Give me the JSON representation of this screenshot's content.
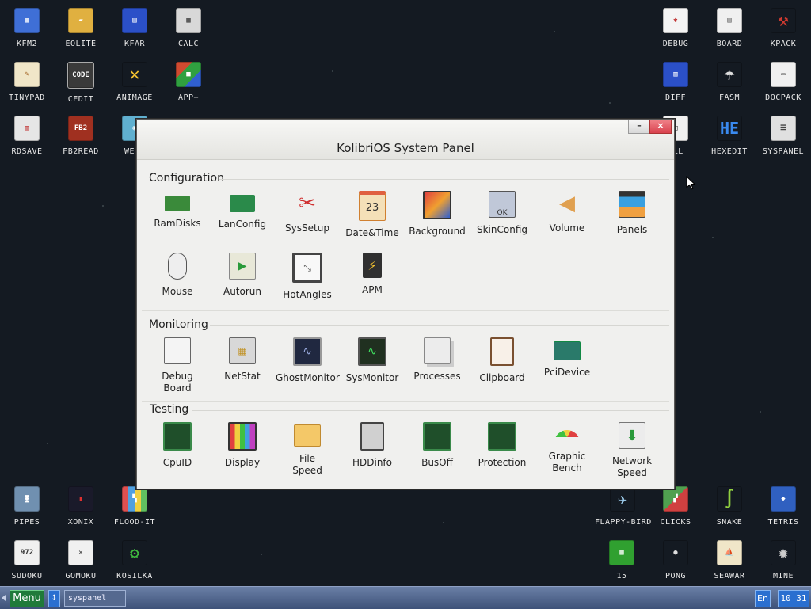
{
  "desktop_left": [
    {
      "label": "KFM2",
      "color": "#3f6fd6",
      "glyph": "▦"
    },
    {
      "label": "EOLITE",
      "color": "#e0b040",
      "glyph": "▰"
    },
    {
      "label": "KFAR",
      "color": "#2b50c8",
      "glyph": "▤"
    },
    {
      "label": "CALC",
      "color": "#d8d8d8",
      "glyph": "▦"
    },
    {
      "label": "TINYPAD",
      "color": "#f0e6c8",
      "glyph": "✎"
    },
    {
      "label": "CEDIT",
      "color": "#3a3a3a",
      "glyph": "CODE"
    },
    {
      "label": "ANIMAGE",
      "color": "#f0c030",
      "glyph": "✕"
    },
    {
      "label": "APP+",
      "color": "#d04a30",
      "glyph": "■"
    },
    {
      "label": "RDSAVE",
      "color": "#e6e6e6",
      "glyph": "▥"
    },
    {
      "label": "FB2READ",
      "color": "#a03020",
      "glyph": "FB2"
    },
    {
      "label": "WEBV",
      "color": "#60b0d0",
      "glyph": "◉"
    }
  ],
  "desktop_right": [
    {
      "label": "DEBUG",
      "color": "#f4f4f4",
      "glyph": "✱"
    },
    {
      "label": "BOARD",
      "color": "#f0f0f0",
      "glyph": "▤"
    },
    {
      "label": "KPACK",
      "color": "#d03a30",
      "glyph": "⚒"
    },
    {
      "label": "DIFF",
      "color": "#2b50c8",
      "glyph": "▥"
    },
    {
      "label": "FASM",
      "color": "#dcdcdc",
      "glyph": "☂"
    },
    {
      "label": "DOCPACK",
      "color": "#f0f0f0",
      "glyph": "▭"
    },
    {
      "label": "ELL",
      "color": "#f0f0f0",
      "glyph": "□"
    },
    {
      "label": "HEXEDIT",
      "color": "#1f5fd0",
      "glyph": "HE"
    },
    {
      "label": "SYSPANEL",
      "color": "#e0e0e0",
      "glyph": "☰"
    }
  ],
  "desktop_bottom": [
    {
      "label": "PIPES",
      "color": "#7090b0",
      "glyph": "◙"
    },
    {
      "label": "XONIX",
      "color": "#1a1a2a",
      "glyph": "▮"
    },
    {
      "label": "FLOOD-IT",
      "color": "#e05050",
      "glyph": "▚"
    },
    {
      "label": "FLAPPY-BIRD",
      "color": "#1a3040",
      "glyph": "✈"
    },
    {
      "label": "CLICKS",
      "color": "#50a050",
      "glyph": "▞"
    },
    {
      "label": "SNAKE",
      "color": "#204020",
      "glyph": "∫"
    },
    {
      "label": "TETRIS",
      "color": "#3060c0",
      "glyph": "◆"
    },
    {
      "label": "SUDOKU",
      "color": "#f0f0f0",
      "glyph": "972"
    },
    {
      "label": "GOMOKU",
      "color": "#f0f0f0",
      "glyph": "✕"
    },
    {
      "label": "KOSILKA",
      "color": "#40a040",
      "glyph": "⚙"
    },
    {
      "label": "15",
      "color": "#30a030",
      "glyph": "▦"
    },
    {
      "label": "PONG",
      "color": "#202830",
      "glyph": "●"
    },
    {
      "label": "SEAWAR",
      "color": "#f0e6c8",
      "glyph": "⛵"
    },
    {
      "label": "MINE",
      "color": "#303030",
      "glyph": "✹"
    }
  ],
  "window": {
    "title": "KolibriOS System Panel",
    "minimize": "–",
    "close": "×"
  },
  "sections": [
    {
      "title": "Configuration",
      "items": [
        {
          "label": "RamDisks",
          "color": "#3a8a3a",
          "icon": "ram-icon"
        },
        {
          "label": "LanConfig",
          "color": "#2a8a4a",
          "icon": "network-card-icon"
        },
        {
          "label": "SysSetup",
          "color": "#e04040",
          "icon": "tools-icon"
        },
        {
          "label": "Date&Time",
          "color": "#f0a040",
          "icon": "calendar-icon",
          "text": "23"
        },
        {
          "label": "Background",
          "color": "#3060d0",
          "icon": "monitor-icon"
        },
        {
          "label": "SkinConfig",
          "color": "#c0c8d8",
          "icon": "skin-icon",
          "text": "OK"
        },
        {
          "label": "Volume",
          "color": "#e0a050",
          "icon": "speaker-icon"
        },
        {
          "label": "Panels",
          "color": "#e0a040",
          "icon": "panels-icon"
        },
        {
          "label": "Mouse",
          "color": "#eeeeee",
          "icon": "mouse-icon"
        },
        {
          "label": "Autorun",
          "color": "#e8e8d8",
          "icon": "autorun-icon"
        },
        {
          "label": "HotAngles",
          "color": "#444444",
          "icon": "hotangles-icon"
        },
        {
          "label": "APM",
          "color": "#303030",
          "icon": "battery-icon"
        }
      ]
    },
    {
      "title": "Monitoring",
      "items": [
        {
          "label": "Debug Board",
          "color": "#f0f0f0",
          "icon": "debug-board-icon"
        },
        {
          "label": "NetStat",
          "color": "#d0d0d0",
          "icon": "netstat-icon"
        },
        {
          "label": "GhostMonitor",
          "color": "#202840",
          "icon": "ghost-monitor-icon"
        },
        {
          "label": "SysMonitor",
          "color": "#203020",
          "icon": "sysmonitor-icon"
        },
        {
          "label": "Processes",
          "color": "#e8e8e8",
          "icon": "processes-icon"
        },
        {
          "label": "Clipboard",
          "color": "#e8d8c8",
          "icon": "clipboard-icon"
        },
        {
          "label": "PciDevice",
          "color": "#2a7a5a",
          "icon": "pci-icon"
        }
      ]
    },
    {
      "title": "Testing",
      "items": [
        {
          "label": "CpuID",
          "color": "#205a30",
          "icon": "cpu-icon"
        },
        {
          "label": "Display",
          "color": "#3060d0",
          "icon": "display-icon"
        },
        {
          "label": "File Speed",
          "color": "#f0c060",
          "icon": "folder-icon"
        },
        {
          "label": "HDDinfo",
          "color": "#404040",
          "icon": "hdd-icon"
        },
        {
          "label": "BusOff",
          "color": "#205a30",
          "icon": "chip-icon"
        },
        {
          "label": "Protection",
          "color": "#205a30",
          "icon": "chip-icon"
        },
        {
          "label": "Graphic Bench",
          "color": "#e05030",
          "icon": "gauge-icon"
        },
        {
          "label": "Network Speed",
          "color": "#e0e0e0",
          "icon": "download-icon"
        }
      ]
    }
  ],
  "taskbar": {
    "menu": "Menu",
    "arrow": "↕",
    "task": "syspanel",
    "lang": "En",
    "clock": "10 31"
  }
}
